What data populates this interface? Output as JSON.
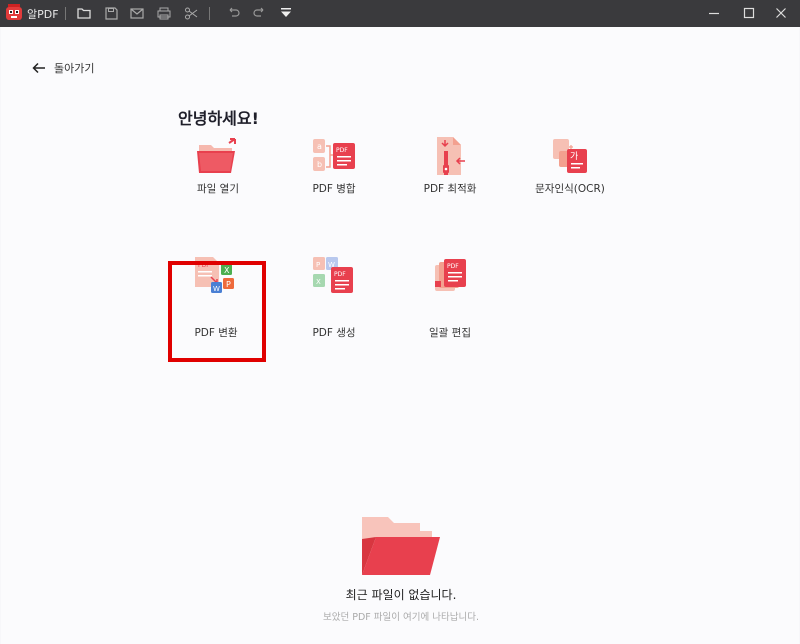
{
  "app": {
    "title": "알PDF"
  },
  "nav": {
    "back_label": "돌아가기"
  },
  "main": {
    "greeting": "안녕하세요!",
    "tiles": [
      {
        "label": "파일 열기",
        "icon": "open-folder-icon"
      },
      {
        "label": "PDF 병합",
        "icon": "merge-pdf-icon"
      },
      {
        "label": "PDF 최적화",
        "icon": "optimize-pdf-icon"
      },
      {
        "label": "문자인식(OCR)",
        "icon": "ocr-icon"
      },
      {
        "label": "PDF 변환",
        "icon": "convert-pdf-icon",
        "highlighted": true
      },
      {
        "label": "PDF 생성",
        "icon": "create-pdf-icon"
      },
      {
        "label": "일괄 편집",
        "icon": "batch-edit-icon"
      }
    ]
  },
  "recent": {
    "empty_title": "최근 파일이 없습니다.",
    "empty_subtitle": "보았던 PDF 파일이 여기에 나타납니다."
  },
  "colors": {
    "accent": "#e8404e",
    "titlebar": "#3a3a3d",
    "highlight": "#e00000"
  }
}
